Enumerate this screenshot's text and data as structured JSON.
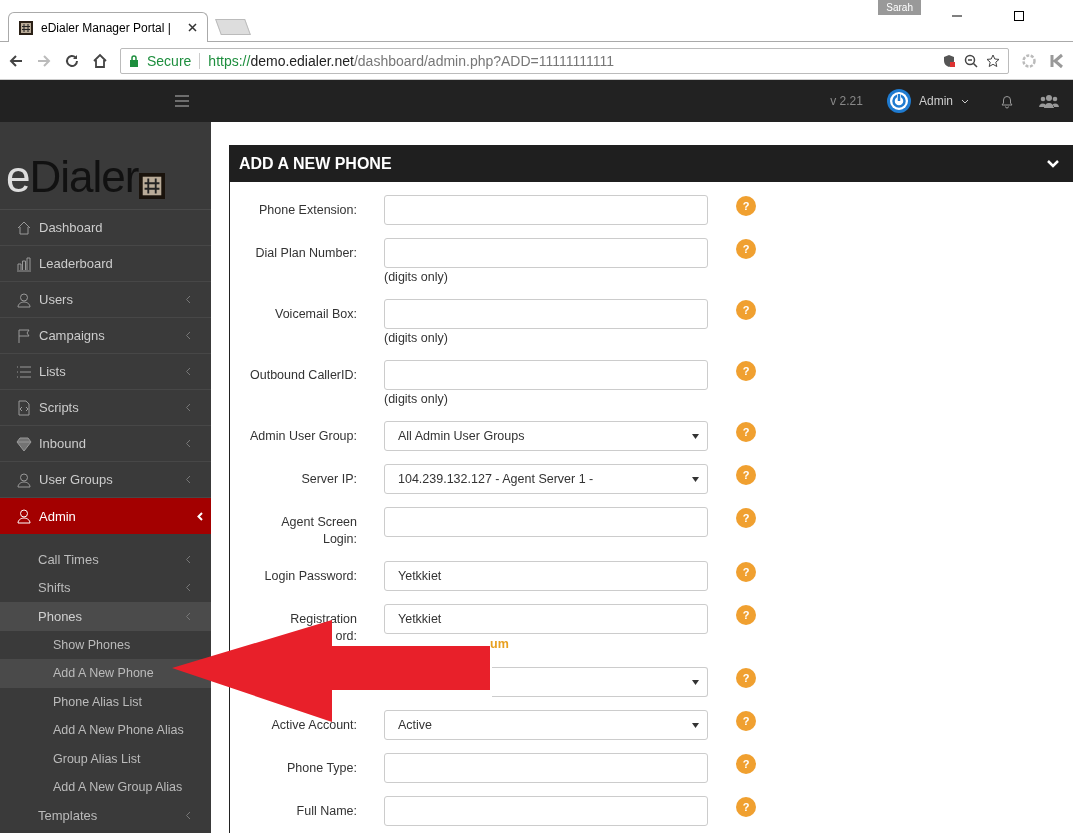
{
  "browser": {
    "tab_title": "eDialer Manager Portal |",
    "profile": "Sarah",
    "secure_label": "Secure",
    "url_scheme": "https://",
    "url_host": "demo.edialer.net",
    "url_path": "/dashboard/admin.php?ADD=11111111111"
  },
  "header": {
    "version": "v 2.21",
    "user": "Admin"
  },
  "logo": {
    "text_light": "e",
    "text_dark": "Dialer"
  },
  "menu": [
    {
      "label": "Dashboard",
      "submenu": false,
      "selected": false
    },
    {
      "label": "Leaderboard",
      "submenu": false,
      "selected": false
    },
    {
      "label": "Users",
      "submenu": true,
      "selected": false
    },
    {
      "label": "Campaigns",
      "submenu": true,
      "selected": false
    },
    {
      "label": "Lists",
      "submenu": true,
      "selected": false
    },
    {
      "label": "Scripts",
      "submenu": true,
      "selected": false
    },
    {
      "label": "Inbound",
      "submenu": true,
      "selected": false
    },
    {
      "label": "User Groups",
      "submenu": true,
      "selected": false
    },
    {
      "label": "Admin",
      "submenu": true,
      "selected": true,
      "children": [
        {
          "label": "Call Times",
          "expanded": false
        },
        {
          "label": "Shifts",
          "expanded": false
        },
        {
          "label": "Phones",
          "expanded": true,
          "children": [
            {
              "label": "Show Phones",
              "selected": false
            },
            {
              "label": "Add A New Phone",
              "selected": true
            },
            {
              "label": "Phone Alias List",
              "selected": false
            },
            {
              "label": "Add A New Phone Alias",
              "selected": false
            },
            {
              "label": "Group Alias List",
              "selected": false
            },
            {
              "label": "Add A New Group Alias",
              "selected": false
            }
          ]
        },
        {
          "label": "Templates",
          "expanded": false
        }
      ]
    }
  ],
  "panel": {
    "title": "ADD A NEW PHONE"
  },
  "fields": [
    {
      "label": "Phone Extension:",
      "kind": "text",
      "help": "?"
    },
    {
      "label": "Dial Plan Number:",
      "kind": "text",
      "hint": "(digits only)",
      "help": "?"
    },
    {
      "label": "Voicemail Box:",
      "kind": "text",
      "hint": "(digits only)",
      "help": "?"
    },
    {
      "label": "Outbound CallerID:",
      "kind": "text",
      "hint": "(digits only)",
      "help": "?"
    },
    {
      "label": "Admin User Group:",
      "kind": "select",
      "value": "All Admin User Groups",
      "help": "?"
    },
    {
      "label": "Server IP:",
      "kind": "select",
      "value": "104.239.132.127 - Agent Server 1 -",
      "help": "?"
    },
    {
      "label": "Agent Screen Login:",
      "kind": "text",
      "help": "?"
    },
    {
      "label": "Login Password:",
      "kind": "text",
      "value": "Yetkkiet",
      "help": "?"
    },
    {
      "label": "Registration",
      "label_end": "ord:",
      "kind": "text",
      "value": "Yetkkiet",
      "strength": "um",
      "help": "?"
    },
    {
      "kind": "select",
      "help": "?"
    },
    {
      "label": "Active Account:",
      "kind": "select",
      "value": "Active",
      "help": "?"
    },
    {
      "label": "Phone Type:",
      "kind": "text",
      "help": "?"
    },
    {
      "label": "Full Name:",
      "kind": "text",
      "help": "?"
    }
  ]
}
